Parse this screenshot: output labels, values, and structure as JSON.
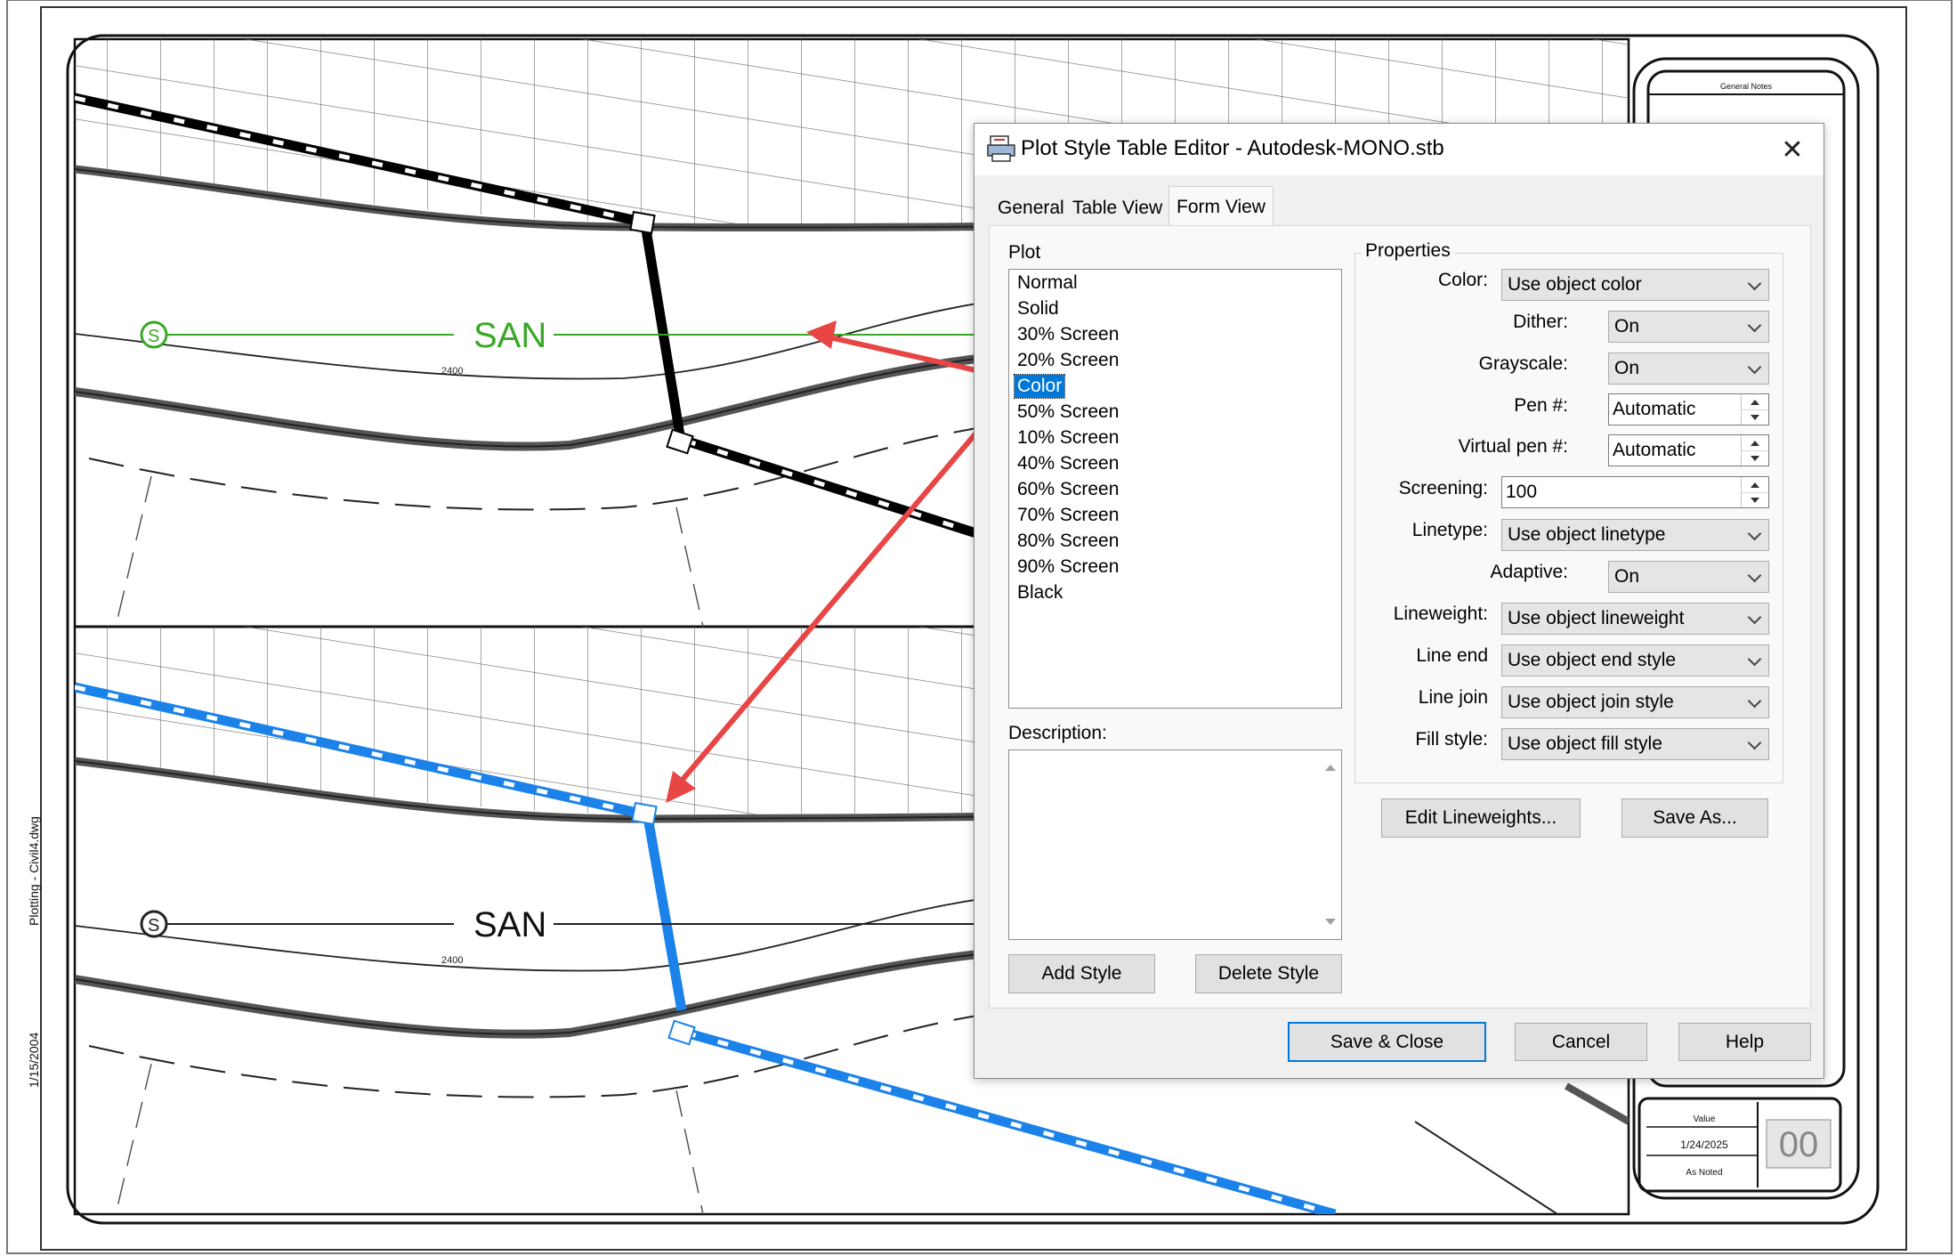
{
  "drawing": {
    "san_label_top": "SAN",
    "san_label_bottom": "SAN",
    "station_top": "2400",
    "station_bottom": "2400",
    "side_text_1": "Plotting - Civil4.dwg",
    "side_text_2": "1/15/2004",
    "titleblock_header": "General Notes",
    "titleblock_project": "Value",
    "titleblock_date": "1/24/2025",
    "titleblock_scale": "As Noted",
    "titleblock_sheet": "00",
    "colors": {
      "san_green": "#3aa827",
      "pipe_blue": "#1a82e8",
      "arrow_red": "#e84545"
    }
  },
  "dialog": {
    "title": "Plot Style Table Editor - Autodesk-MONO.stb",
    "close_glyph": "✕",
    "tabs": [
      "General",
      "Table View",
      "Form View"
    ],
    "active_tab": "Form View",
    "plot_label": "Plot",
    "plot_styles": [
      "Normal",
      "Solid",
      "30% Screen",
      "20% Screen",
      "Color",
      "50% Screen",
      "10% Screen",
      "40% Screen",
      "60% Screen",
      "70% Screen",
      "80% Screen",
      "90% Screen",
      "Black"
    ],
    "selected_style": "Color",
    "description_label": "Description:",
    "description_value": "",
    "add_style": "Add Style",
    "delete_style": "Delete Style",
    "properties_label": "Properties",
    "properties": {
      "color": {
        "label": "Color:",
        "value": "Use object color"
      },
      "dither": {
        "label": "Dither:",
        "value": "On"
      },
      "grayscale": {
        "label": "Grayscale:",
        "value": "On"
      },
      "pen": {
        "label": "Pen #:",
        "value": "Automatic"
      },
      "virtual_pen": {
        "label": "Virtual pen #:",
        "value": "Automatic"
      },
      "screening": {
        "label": "Screening:",
        "value": "100"
      },
      "linetype": {
        "label": "Linetype:",
        "value": "Use object linetype"
      },
      "adaptive": {
        "label": "Adaptive:",
        "value": "On"
      },
      "lineweight": {
        "label": "Lineweight:",
        "value": "Use object lineweight"
      },
      "line_end": {
        "label": "Line end",
        "value": "Use object end style"
      },
      "line_join": {
        "label": "Line join",
        "value": "Use object join style"
      },
      "fill_style": {
        "label": "Fill style:",
        "value": "Use object fill style"
      }
    },
    "edit_lineweights": "Edit Lineweights...",
    "save_as": "Save As...",
    "save_close": "Save & Close",
    "cancel": "Cancel",
    "help": "Help",
    "colors": {
      "selection": "#0078d7"
    }
  }
}
